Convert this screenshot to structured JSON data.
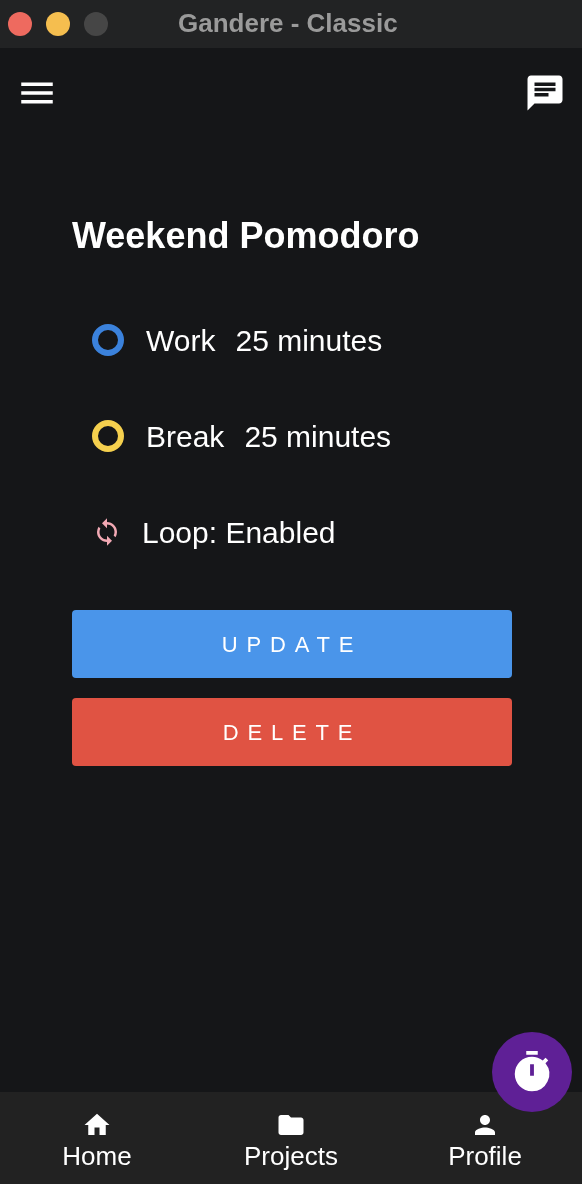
{
  "window": {
    "title": "Gandere - Classic"
  },
  "title": "Weekend Pomodoro",
  "items": [
    {
      "kind": "phase",
      "label": "Work",
      "value": "25 minutes",
      "color": "#3b82dc"
    },
    {
      "kind": "phase",
      "label": "Break",
      "value": "25 minutes",
      "color": "#f5d04e"
    },
    {
      "kind": "loop",
      "label": "Loop: Enabled"
    }
  ],
  "buttons": [
    {
      "label": "UPDATE",
      "kind": "primary"
    },
    {
      "label": "DELETE",
      "kind": "danger"
    }
  ],
  "nav": [
    {
      "label": "Home"
    },
    {
      "label": "Projects"
    },
    {
      "label": "Profile"
    }
  ]
}
